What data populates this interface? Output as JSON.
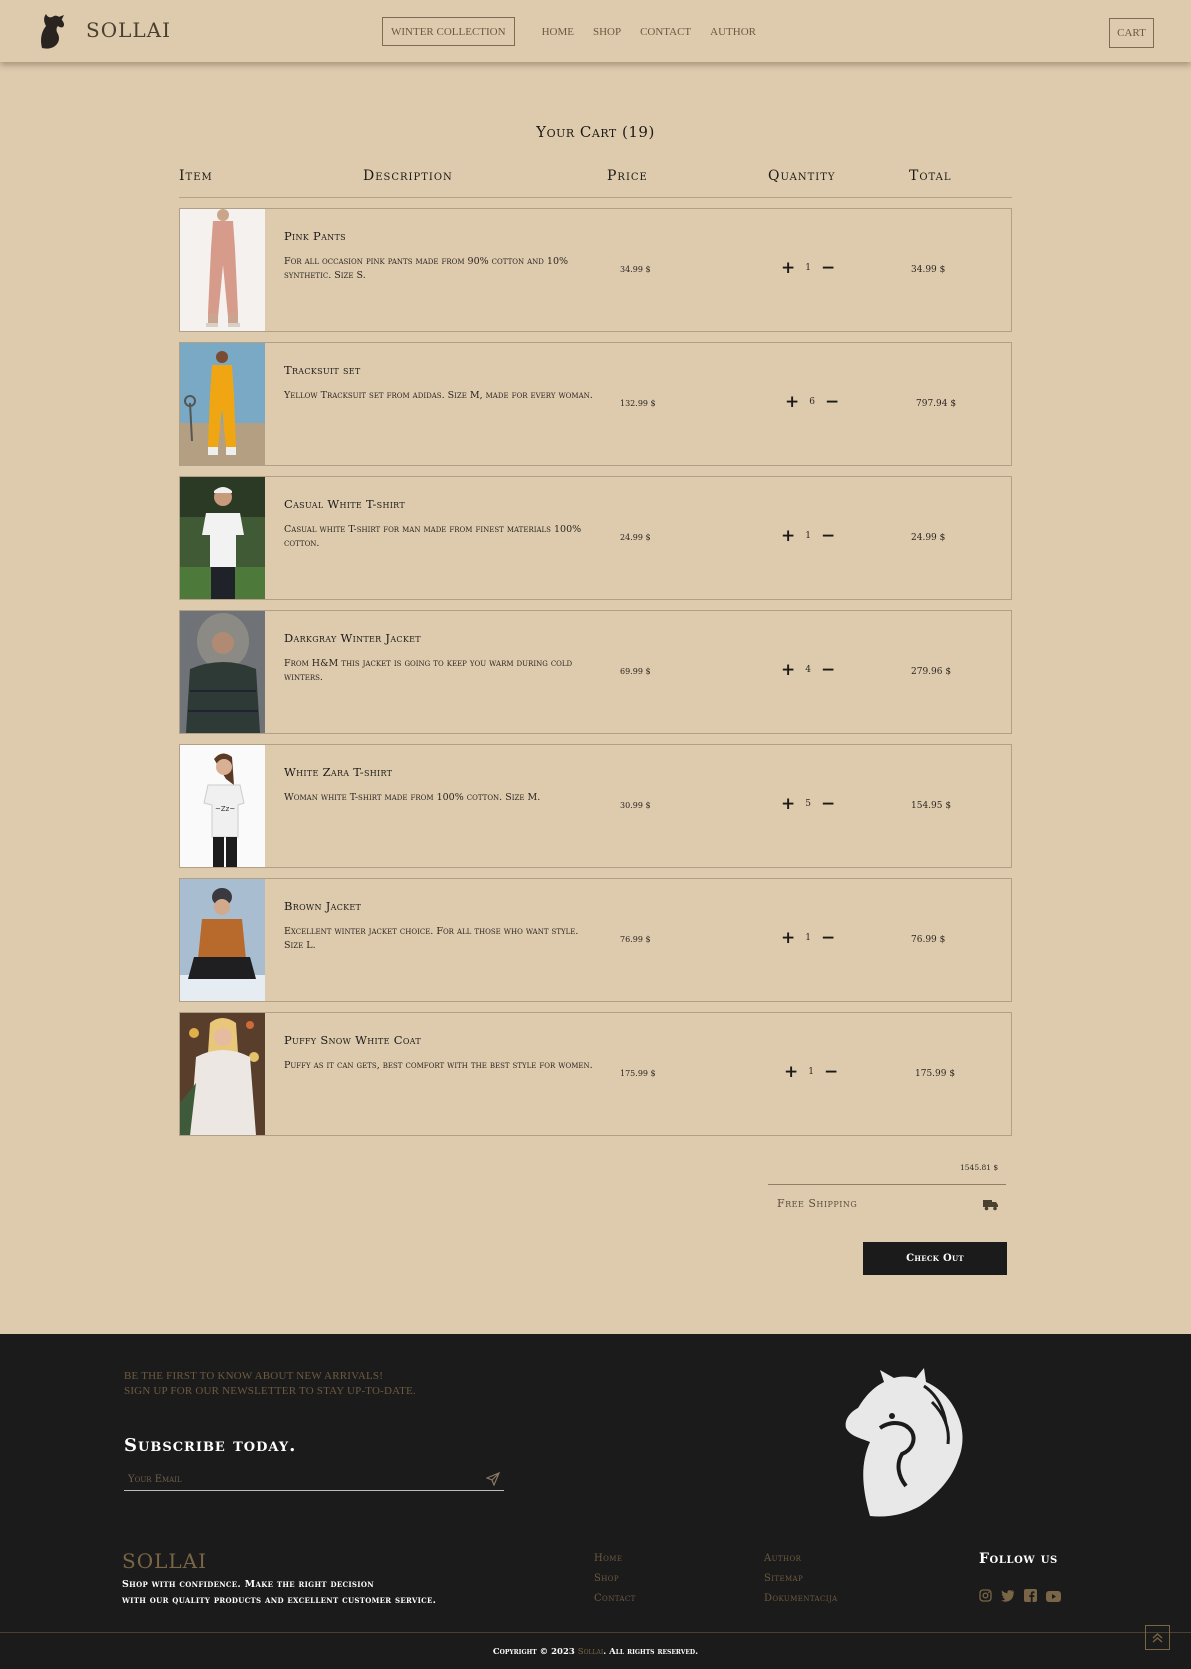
{
  "header": {
    "brand": "SOLLAI",
    "nav": [
      "WINTER COLLECTION",
      "HOME",
      "SHOP",
      "CONTACT",
      "AUTHOR"
    ],
    "cart_label": "CART"
  },
  "cart": {
    "title": "Your Cart (19)",
    "columns": [
      "Item",
      "Description",
      "Price",
      "Quantity",
      "Total"
    ],
    "items": [
      {
        "name": "Pink Pants",
        "desc": "For all occasion pink pants made from 90% cotton and 10% synthetic. Size S.",
        "price": "34.99 $",
        "qty": "1",
        "total": "34.99 $"
      },
      {
        "name": "Tracksuit set",
        "desc": "Yellow Tracksuit set from adidas. Size M, made for every woman.",
        "price": "132.99 $",
        "qty": "6",
        "total": "797.94 $"
      },
      {
        "name": "Casual White T-shirt",
        "desc": "Casual white T-shirt for man made from finest materials 100% cotton.",
        "price": "24.99 $",
        "qty": "1",
        "total": "24.99 $"
      },
      {
        "name": "Darkgray Winter Jacket",
        "desc": "From H&M this jacket is going to keep you warm during cold winters.",
        "price": "69.99 $",
        "qty": "4",
        "total": "279.96 $"
      },
      {
        "name": "White Zara T-shirt",
        "desc": "Woman white T-shirt made from 100% cotton. Size M.",
        "price": "30.99 $",
        "qty": "5",
        "total": "154.95 $"
      },
      {
        "name": "Brown Jacket",
        "desc": "Excellent winter jacket choice. For all those who want style. Size L.",
        "price": "76.99 $",
        "qty": "1",
        "total": "76.99 $"
      },
      {
        "name": "Puffy Snow White Coat",
        "desc": "Puffy as it can gets, best comfort with the best style for women.",
        "price": "175.99 $",
        "qty": "1",
        "total": "175.99 $"
      }
    ],
    "qty_plus": "+",
    "qty_minus": "−",
    "grand_total": "1545.81 $",
    "shipping_label": "Free Shipping",
    "checkout_label": "Check Out"
  },
  "footer": {
    "newsletter_line1": "BE THE FIRST TO KNOW ABOUT NEW ARRIVALS!",
    "newsletter_line2": "SIGN UP FOR OUR NEWSLETTER TO STAY UP-TO-DATE.",
    "subscribe_title": "Subscribe today.",
    "email_placeholder": "Your Email",
    "brand": "SOLLAI",
    "tagline1": "Shop with confidence. Make the right decision",
    "tagline2": "with our quality products and excellent customer service.",
    "links_col1": [
      "Home",
      "Shop",
      "Contact"
    ],
    "links_col2": [
      "Author",
      "Sitemap",
      "Dokumentacija"
    ],
    "follow_title": "Follow us",
    "socials": [
      "instagram-icon",
      "twitter-icon",
      "facebook-icon",
      "youtube-icon"
    ],
    "copyright_pre": "Copyright © 2023",
    "copyright_brand": "Sollai",
    "copyright_post": ". All rights reserved."
  },
  "colors": {
    "page_bg": "#decbae",
    "footer_bg": "#1b1b1c",
    "accent_brown": "#7a6546",
    "button_dark": "#1b1b1c"
  }
}
